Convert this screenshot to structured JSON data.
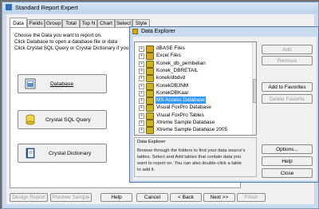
{
  "main_window": {
    "title": "Standard Report Expert",
    "tabs": [
      "Data",
      "Fields",
      "Group",
      "Total",
      "Top N",
      "Chart",
      "Select",
      "Style"
    ],
    "instructions": [
      "Choose the Data you want to report on.",
      "Click Database to open a database file or data",
      "Click Crystal SQL Query or Crystal Dictionary if you"
    ],
    "buttons": {
      "database": "Database",
      "sql_query": "Crystal SQL Query",
      "dictionary": "Crystal Dictionary"
    },
    "footer": {
      "design_report": "Design Report",
      "preview_sample": "Preview Sample",
      "help": "Help",
      "cancel": "Cancel",
      "back": "< Back",
      "next": "Next >>",
      "finish": "Finish"
    }
  },
  "dialog": {
    "title": "Data Explorer",
    "tree_items": [
      {
        "label": "dBASE Files",
        "color": "#d9a520"
      },
      {
        "label": "Excel Files",
        "color": "#d9a520"
      },
      {
        "label": "Konek_db_pembelian",
        "color": "#c9b320"
      },
      {
        "label": "Konek_DBRETAIL",
        "color": "#c9b320"
      },
      {
        "label": "konek/dbdvd",
        "color": "#c9b320"
      },
      {
        "label": "KonekDBJNM",
        "color": "#c9b320"
      },
      {
        "label": "KonekDBKaar",
        "color": "#c9b320"
      },
      {
        "label": "MS Access Database",
        "color": "#c9b320",
        "selected": true
      },
      {
        "label": "Visual FoxPro Database",
        "color": "#c9b320"
      },
      {
        "label": "Visual FoxPro Tables",
        "color": "#c9b320"
      },
      {
        "label": "Xtreme Sample Database",
        "color": "#c9b320"
      },
      {
        "label": "Xtreme Sample Database 2005",
        "color": "#c9b320"
      }
    ],
    "buttons": {
      "add": "Add",
      "remove": "Remove",
      "add_favorites": "Add to Favorites",
      "delete_favorite": "Delete Favorite",
      "options": "Options...",
      "help": "Help",
      "close": "Close"
    },
    "description": {
      "heading": "Data Explorer",
      "lines": [
        "Browse through the folders to find your data source's",
        "tables.  Select and Add tables that contain data you",
        "want to report on.  You can also double-click a table",
        "to add it."
      ]
    }
  }
}
